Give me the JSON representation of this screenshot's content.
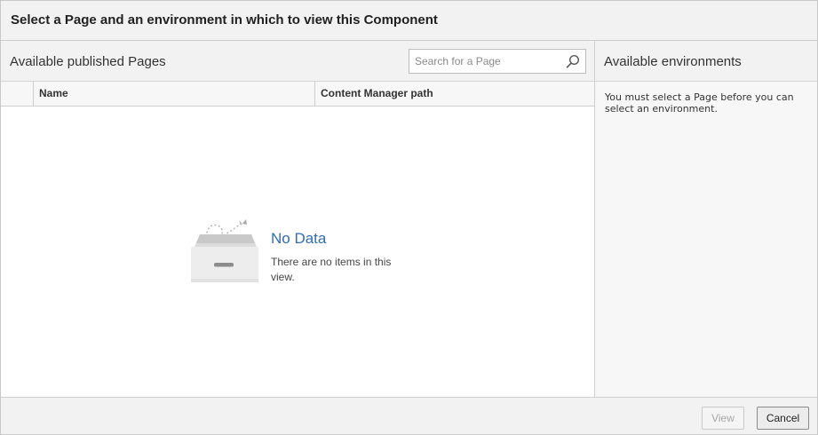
{
  "dialog": {
    "title": "Select a Page and an environment in which to view this Component"
  },
  "pages_pane": {
    "title": "Available published Pages",
    "search": {
      "placeholder": "Search for a Page",
      "value": ""
    },
    "columns": {
      "name": "Name",
      "path": "Content Manager path"
    },
    "empty_state": {
      "title": "No Data",
      "message": "There are no items in this view."
    }
  },
  "environments_pane": {
    "title": "Available environments",
    "message": "You must select a Page before you can select an environment."
  },
  "footer": {
    "view_label": "View",
    "cancel_label": "Cancel"
  },
  "colors": {
    "accent": "#2e6db4",
    "header_bg": "#f2f2f2",
    "border": "#cfcfcf"
  },
  "icons": [
    "search-icon",
    "empty-box-icon"
  ]
}
